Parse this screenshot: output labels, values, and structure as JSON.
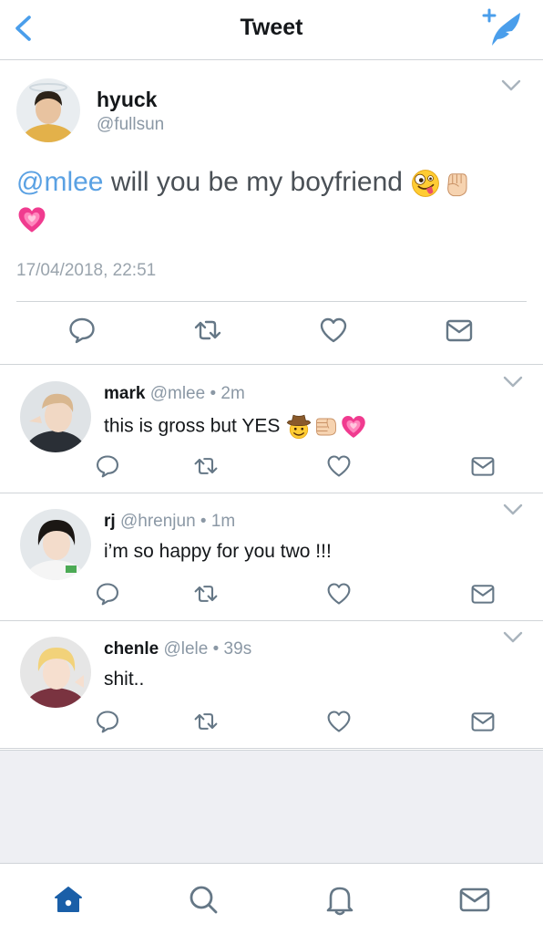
{
  "header": {
    "title": "Tweet",
    "accent": "#4a9eeb"
  },
  "main_tweet": {
    "name": "hyuck",
    "handle": "@fullsun",
    "mention": "@mlee",
    "text": " will you be my boyfriend",
    "emojis": [
      "zany-face-emoji",
      "raised-fist-emoji",
      "growing-heart-emoji"
    ],
    "timestamp": "17/04/2018, 22:51",
    "actions": [
      "reply-icon",
      "retweet-icon",
      "like-icon",
      "message-icon"
    ]
  },
  "replies": [
    {
      "name": "mark",
      "meta": " @mlee • 2m",
      "text": "this is gross but YES",
      "emojis": [
        "cowboy-face-emoji",
        "fist-bump-emoji",
        "growing-heart-emoji"
      ]
    },
    {
      "name": "rj",
      "meta": " @hrenjun • 1m",
      "text": "i’m so happy for you two !!!",
      "emojis": []
    },
    {
      "name": "chenle",
      "meta": " @lele • 39s",
      "text": "shit..",
      "emojis": []
    }
  ],
  "tabbar": {
    "items": [
      "home-icon",
      "search-icon",
      "notifications-icon",
      "messages-icon"
    ],
    "active_color": "#1a5fa8",
    "inactive_color": "#657786"
  }
}
